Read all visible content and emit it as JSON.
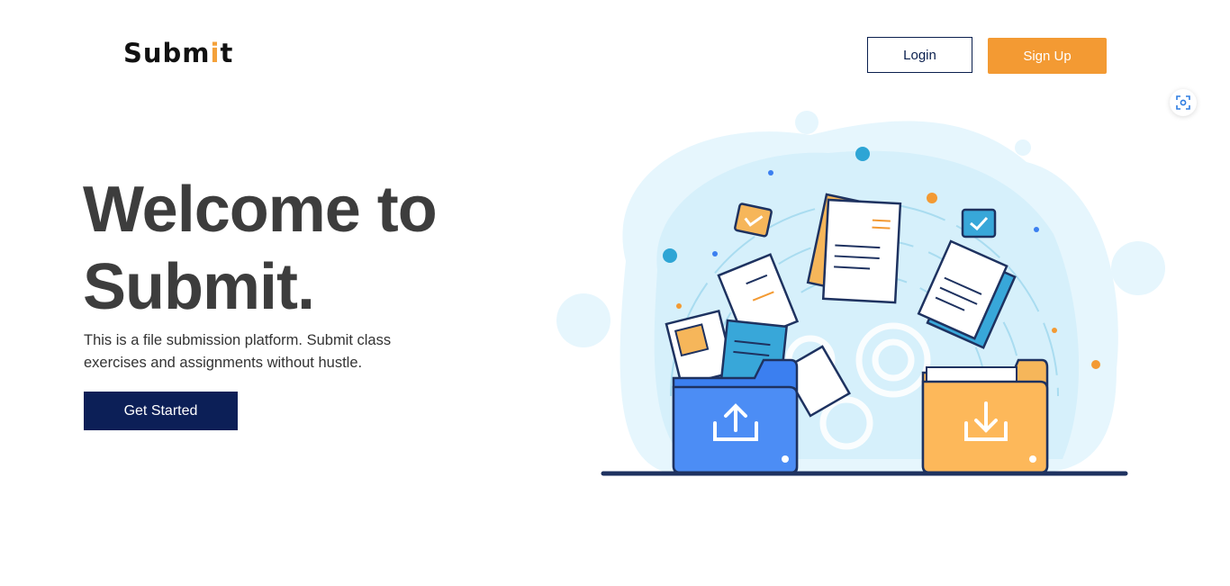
{
  "header": {
    "logo_main": "Subm",
    "logo_accent": "i",
    "logo_end": "t",
    "login_label": "Login",
    "signup_label": "Sign Up"
  },
  "hero": {
    "title_line1": "Welcome to",
    "title_line2": "Submit.",
    "description": "This is a file submission platform. Submit class exercises and assignments without hustle.",
    "cta_label": "Get Started"
  },
  "colors": {
    "primary_navy": "#0c1f57",
    "accent_orange": "#f39a33",
    "upload_blue": "#3b7ff0",
    "light_blue": "#dff3fb"
  },
  "icons": {
    "float_button": "screenshot-capture-icon",
    "upload_folder": "upload-icon",
    "download_folder": "download-icon"
  }
}
